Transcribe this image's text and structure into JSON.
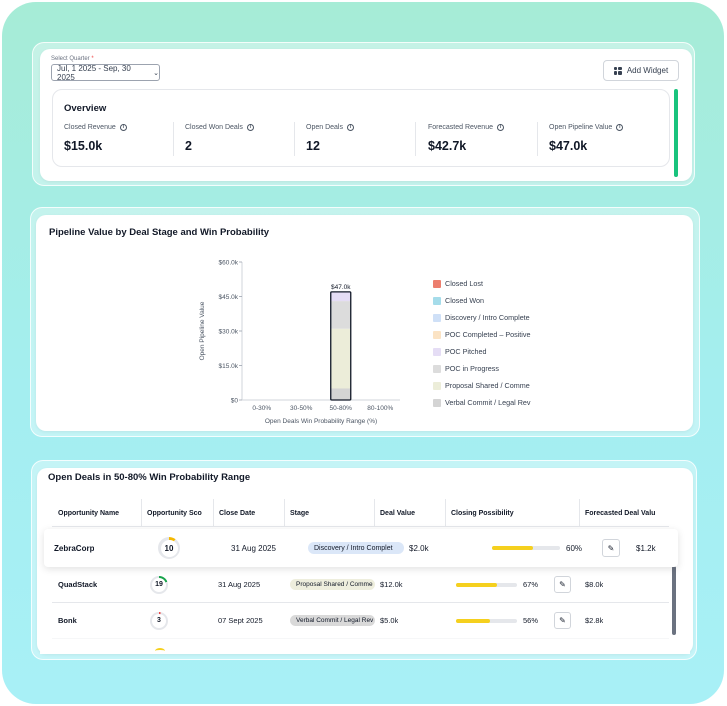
{
  "filters": {
    "quarter_label": "Select Quarter",
    "quarter_required": "*",
    "quarter_value": "Jul, 1 2025 - Sep, 30 2025"
  },
  "toolbar": {
    "add_widget_label": "Add Widget"
  },
  "overview": {
    "title": "Overview",
    "kpis": [
      {
        "label": "Closed Revenue",
        "value": "$15.0k"
      },
      {
        "label": "Closed Won Deals",
        "value": "2"
      },
      {
        "label": "Open Deals",
        "value": "12"
      },
      {
        "label": "Forecasted Revenue",
        "value": "$42.7k"
      },
      {
        "label": "Open Pipeline Value",
        "value": "$47.0k"
      }
    ]
  },
  "pipeline_chart": {
    "title": "Pipeline Value by Deal Stage and Win Probability"
  },
  "chart_data": {
    "type": "bar",
    "stacked": true,
    "title": "Pipeline Value by Deal Stage and Win Probability",
    "xlabel": "Open Deals Win Probability Range (%)",
    "ylabel": "Open Pipeline Value",
    "categories": [
      "0-30%",
      "30-50%",
      "50-80%",
      "80-100%"
    ],
    "yticks": [
      "$0",
      "$15.0k",
      "$30.0k",
      "$45.0k",
      "$60.0k"
    ],
    "ylim": [
      0,
      60000
    ],
    "total_labels": [
      "",
      "",
      "$47.0k",
      ""
    ],
    "highlighted_category": "50-80%",
    "series": [
      {
        "name": "Closed Lost",
        "color": "#ec7e6e",
        "values": [
          0,
          0,
          0,
          0
        ]
      },
      {
        "name": "Closed Won",
        "color": "#a5dcea",
        "values": [
          0,
          0,
          0,
          0
        ]
      },
      {
        "name": "Discovery / Intro Completed",
        "color": "#cfe0f7",
        "values": [
          0,
          0,
          0,
          0
        ]
      },
      {
        "name": "POC Completed – Positive",
        "color": "#fbe3c4",
        "values": [
          0,
          0,
          0,
          0
        ]
      },
      {
        "name": "POC Pitched",
        "color": "#e5ddf5",
        "values": [
          0,
          0,
          0,
          0
        ]
      },
      {
        "name": "POC in Progress",
        "color": "#dcdcdc",
        "values": [
          0,
          0,
          0,
          0
        ]
      },
      {
        "name": "Proposal Shared / Commercials",
        "color": "#ecedd9",
        "values": [
          0,
          0,
          0,
          0
        ]
      },
      {
        "name": "Verbal Commit / Legal Review",
        "color": "#d4d4d4",
        "values": [
          0,
          0,
          5000,
          0
        ]
      }
    ],
    "stack_segments_50_80": [
      {
        "series": "Verbal Commit / Legal Review",
        "value": 5000
      },
      {
        "series": "Proposal Shared / Commercials",
        "value": 26000
      },
      {
        "series": "POC in Progress",
        "value": 12000
      },
      {
        "series": "POC Pitched",
        "value": 4000
      }
    ],
    "legend": {
      "position": "right",
      "entries": [
        "Closed Lost",
        "Closed Won",
        "Discovery / Intro Complete",
        "POC Completed – Positive",
        "POC Pitched",
        "POC in Progress",
        "Proposal Shared / Comme",
        "Verbal Commit / Legal Rev"
      ]
    },
    "grid": false
  },
  "open_deals": {
    "title": "Open Deals in 50-80% Win Probability Range",
    "columns": [
      "Opportunity Name",
      "Opportunity Sco",
      "Close Date",
      "Stage",
      "Deal Value",
      "Closing Possibility",
      "Forecasted Deal Valu"
    ],
    "rows": [
      {
        "name": "ZebraCorp",
        "score": "10",
        "score_fraction": 0.1,
        "score_color": "#f5b800",
        "close_date": "31 Aug 2025",
        "stage": "Discovery / Intro Complet",
        "stage_color": "#dbe7f8",
        "deal_value": "$2.0k",
        "possibility": "60%",
        "possibility_fraction": 0.6,
        "forecast": "$1.2k"
      },
      {
        "name": "QuadStack",
        "score": "19",
        "score_fraction": 0.19,
        "score_color": "#16a34a",
        "close_date": "31 Aug 2025",
        "stage": "Proposal Shared / Comme",
        "stage_color": "#eeeedd",
        "deal_value": "$12.0k",
        "possibility": "67%",
        "possibility_fraction": 0.67,
        "forecast": "$8.0k"
      },
      {
        "name": "Bonk",
        "score": "3",
        "score_fraction": 0.03,
        "score_color": "#ef4444",
        "close_date": "07 Sept 2025",
        "stage": "Verbal Commit / Legal Rev",
        "stage_color": "#d9d9d9",
        "deal_value": "$5.0k",
        "possibility": "56%",
        "possibility_fraction": 0.56,
        "forecast": "$2.8k"
      }
    ]
  }
}
